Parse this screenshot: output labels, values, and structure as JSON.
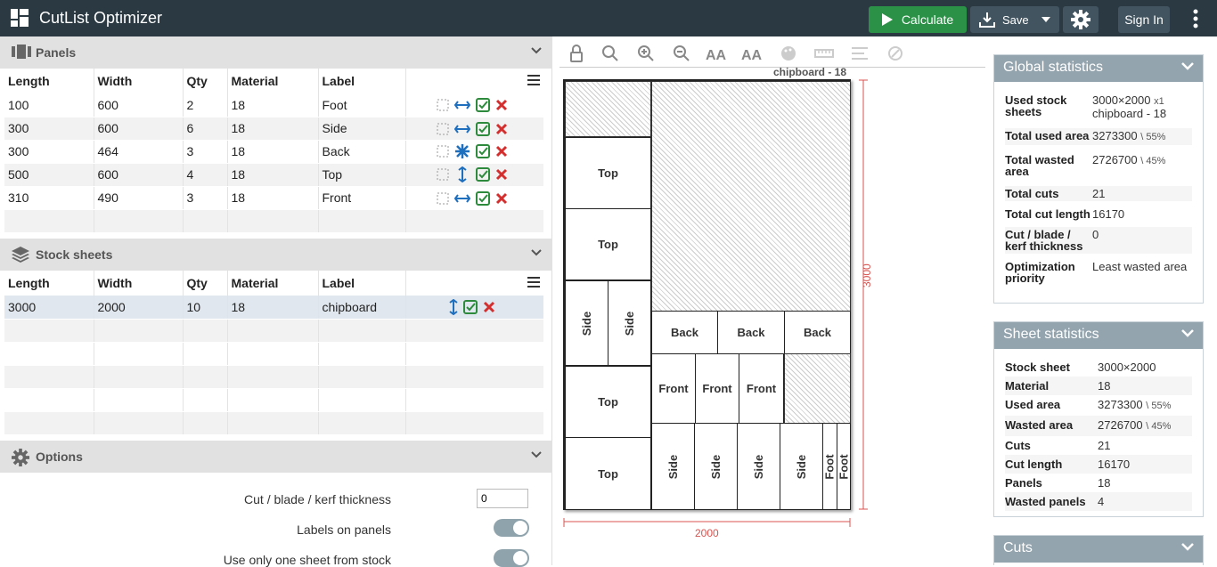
{
  "app": {
    "title": "CutList Optimizer"
  },
  "toolbar": {
    "calculate": "Calculate",
    "save": "Save",
    "signin": "Sign In"
  },
  "panels": {
    "title": "Panels",
    "columns": [
      "Length",
      "Width",
      "Qty",
      "Material",
      "Label"
    ],
    "rows": [
      {
        "length": "100",
        "width": "600",
        "qty": "2",
        "material": "18",
        "label": "Foot",
        "grain": "horizontal"
      },
      {
        "length": "300",
        "width": "600",
        "qty": "6",
        "material": "18",
        "label": "Side",
        "grain": "horizontal"
      },
      {
        "length": "300",
        "width": "464",
        "qty": "3",
        "material": "18",
        "label": "Back",
        "grain": "any"
      },
      {
        "length": "500",
        "width": "600",
        "qty": "4",
        "material": "18",
        "label": "Top",
        "grain": "vertical"
      },
      {
        "length": "310",
        "width": "490",
        "qty": "3",
        "material": "18",
        "label": "Front",
        "grain": "horizontal"
      }
    ]
  },
  "stock": {
    "title": "Stock sheets",
    "columns": [
      "Length",
      "Width",
      "Qty",
      "Material",
      "Label"
    ],
    "rows": [
      {
        "length": "3000",
        "width": "2000",
        "qty": "10",
        "material": "18",
        "label": "chipboard"
      }
    ]
  },
  "options": {
    "title": "Options",
    "kerf_label": "Cut / blade / kerf thickness",
    "kerf_value": "0",
    "labels_label": "Labels on panels",
    "one_sheet_label": "Use only one sheet from stock"
  },
  "diagram": {
    "sheet_title": "chipboard - 18",
    "width_label": "2000",
    "height_label": "3000",
    "panel_labels": [
      "Top",
      "Top",
      "Side",
      "Side",
      "Back",
      "Back",
      "Back",
      "Top",
      "Front",
      "Front",
      "Front",
      "Top",
      "Side",
      "Side",
      "Side",
      "Side",
      "Foot",
      "Foot"
    ]
  },
  "global_stats": {
    "title": "Global statistics",
    "rows": [
      {
        "k": "Used stock sheets",
        "v": "3000×2000",
        "extra": "x1",
        "v2": "chipboard - 18"
      },
      {
        "k": "Total used area",
        "v": "3273300",
        "extra": "\\ 55%"
      },
      {
        "k": "Total wasted area",
        "v": "2726700",
        "extra": "\\ 45%"
      },
      {
        "k": "Total cuts",
        "v": "21"
      },
      {
        "k": "Total cut length",
        "v": "16170"
      },
      {
        "k": "Cut / blade / kerf thickness",
        "v": "0"
      },
      {
        "k": "Optimization priority",
        "v": "Least wasted area"
      }
    ]
  },
  "sheet_stats": {
    "title": "Sheet statistics",
    "rows": [
      {
        "k": "Stock sheet",
        "v": "3000×2000"
      },
      {
        "k": "Material",
        "v": "18"
      },
      {
        "k": "Used area",
        "v": "3273300",
        "extra": "\\ 55%"
      },
      {
        "k": "Wasted area",
        "v": "2726700",
        "extra": "\\ 45%"
      },
      {
        "k": "Cuts",
        "v": "21"
      },
      {
        "k": "Cut length",
        "v": "16170"
      },
      {
        "k": "Panels",
        "v": "18"
      },
      {
        "k": "Wasted panels",
        "v": "4"
      }
    ]
  },
  "cuts": {
    "title": "Cuts"
  },
  "colors": {
    "topbar": "#2a3942",
    "calculate": "#2a9147",
    "accent_blue": "#1f6fbf",
    "delete_red": "#d32f2f",
    "check_green": "#2e8b3d",
    "dim_red": "#d9534f"
  }
}
